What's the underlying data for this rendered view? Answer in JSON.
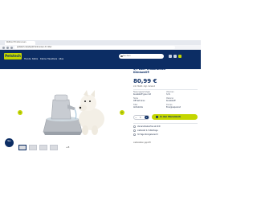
{
  "browser": {
    "tab_title": "Petfood Trinkbrunnen",
    "url": "petstech.de/shop/trinkbrunnen-3-7-liter"
  },
  "header": {
    "logo": "Petstech",
    "search_placeholder": "Suchen",
    "menu": [
      "Hunde",
      "Katze",
      "Kleine Haustiere",
      "Alles"
    ]
  },
  "product": {
    "title_lines": [
      "3,7 Liter Trinkbrunnen",
      "Drinkwell®"
    ],
    "price": "80,99 €",
    "vat_note": "inkl. MwSt. zzgl. Versand",
    "specs": [
      {
        "key": "Fassungsvermögen",
        "value": "Kunststoff grau mit"
      },
      {
        "key": "Volumen",
        "value": "3,7L"
      },
      {
        "key": "Farbe",
        "value": "Off-Set Grau"
      },
      {
        "key": "Material",
        "value": "Kunststoff"
      },
      {
        "key": "Filter",
        "value": "Aktivkohle"
      },
      {
        "key": "Pumpe",
        "value": "Energiesparend"
      }
    ],
    "quantity": "1",
    "add_to_cart": "In den Warenkorb",
    "delivery": [
      "Versandkostenfrei ab 49 €",
      "Lieferzeit 2-3 Werktage",
      "30 Tage Rückgaberecht"
    ],
    "footnote": "Lieferzeiten geprüft"
  },
  "gallery": {
    "badge": "Neu",
    "more": "+3"
  },
  "colors": {
    "brand_navy": "#0c2d64",
    "brand_lime": "#c4d600"
  }
}
